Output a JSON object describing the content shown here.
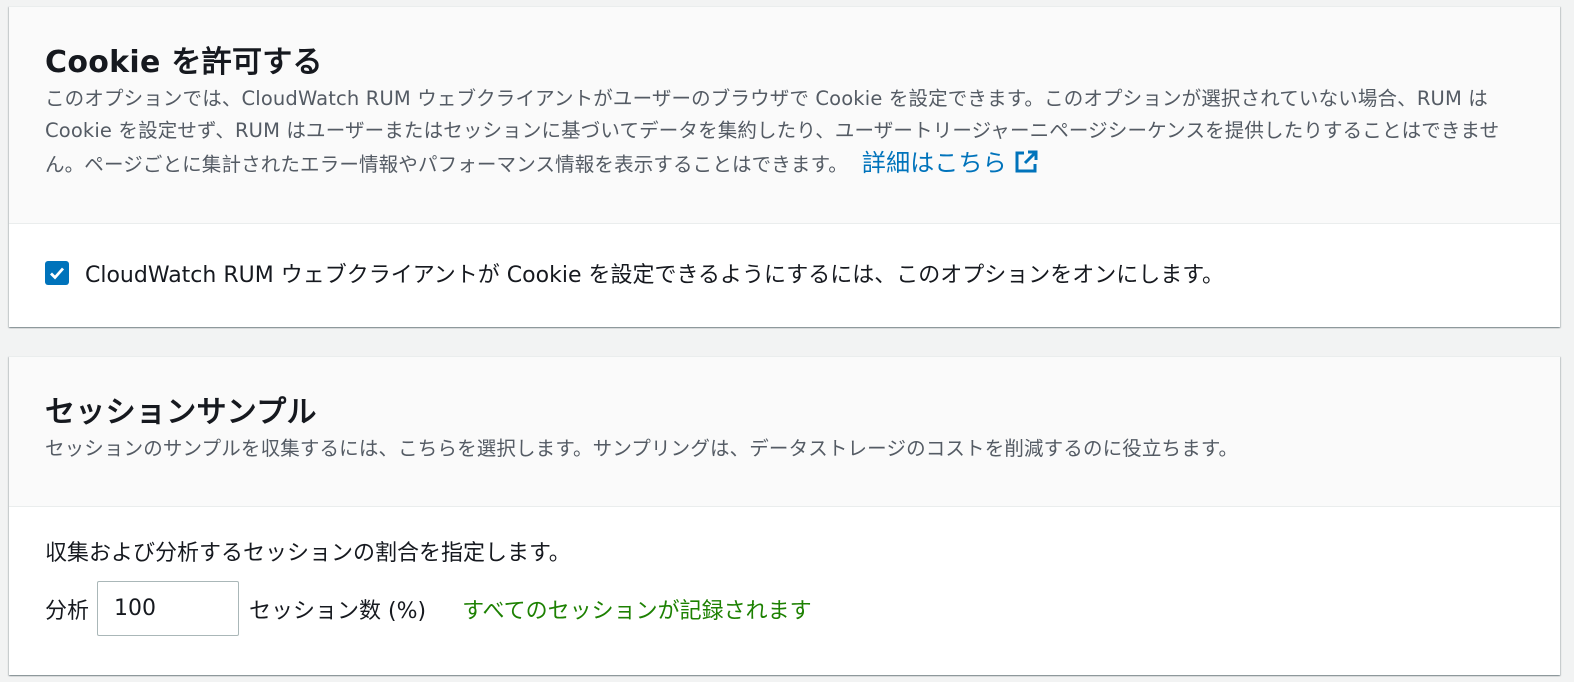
{
  "cookie_panel": {
    "title": "Cookie を許可する",
    "description": "このオプションでは、CloudWatch RUM ウェブクライアントがユーザーのブラウザで Cookie を設定できます。このオプションが選択されていない場合、RUM は Cookie を設定せず、RUM はユーザーまたはセッションに基づいてデータを集約したり、ユーザートリージャーニページシーケンスを提供したりすることはできません。ページごとに集計されたエラー情報やパフォーマンス情報を表示することはできます。",
    "learn_more_label": "詳細はこちら",
    "learn_more_icon": "external-link-icon",
    "checkbox_checked": true,
    "checkbox_label": "CloudWatch RUM ウェブクライアントが Cookie を設定できるようにするには、このオプションをオンにします。"
  },
  "session_panel": {
    "title": "セッションサンプル",
    "description": "セッションのサンプルを収集するには、こちらを選択します。サンプリングは、データストレージのコストを削減するのに役立ちます。",
    "body_label": "収集および分析するセッションの割合を指定します。",
    "input_prefix": "分析",
    "input_value": "100",
    "input_suffix": "セッション数 (%)",
    "status_text": "すべてのセッションが記録されます"
  },
  "colors": {
    "link": "#0073bb",
    "checkbox": "#0073bb",
    "success": "#1d8102",
    "background": "#f2f3f3"
  }
}
